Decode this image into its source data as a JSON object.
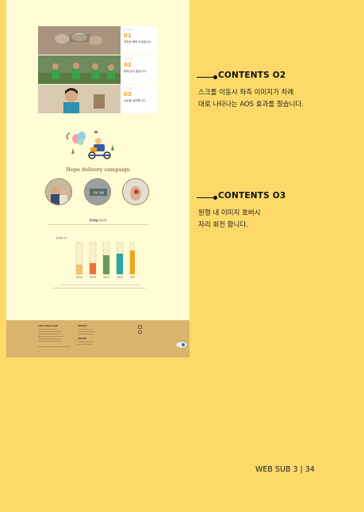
{
  "preview": {
    "cards": [
      {
        "small": "VOLUNTEER",
        "num": "01",
        "text": "따뜻한 행복 모금합니다."
      },
      {
        "small": "VOLUNTEER",
        "num": "02",
        "text": "함께 같이 돕습니다."
      },
      {
        "small": "VOLUNTEER",
        "num": "03",
        "text": "나눔을 실천합니다."
      }
    ],
    "campaign_title": "Hope delivery campaign",
    "circle_label": "기분 전환",
    "section_title": "희망배달 더보기?",
    "chart": {
      "label": "희망배달 모금",
      "years": [
        "2014",
        "2015",
        "2017",
        "2019",
        "2020"
      ]
    },
    "footer": {
      "col1_title": "LINE SUGAR CLUB",
      "col2_title": "SERVICE",
      "col3_title": "CENTER"
    }
  },
  "chart_data": {
    "type": "bar",
    "categories": [
      "2014",
      "2015",
      "2017",
      "2019",
      "2020"
    ],
    "values": [
      30,
      35,
      60,
      65,
      75
    ],
    "ylim": [
      0,
      100
    ],
    "colors": [
      "#f2c36b",
      "#e8743b",
      "#6a9a5a",
      "#2aa6a8",
      "#f3a21c"
    ]
  },
  "contents": [
    {
      "label": "CONTENTS O2",
      "lines": [
        "스크롤 이동시 좌측 이미지가 차례",
        "대로 나타나는 AOS 효과를 줬습니다."
      ]
    },
    {
      "label": "CONTENTS O3",
      "lines": [
        "원형 내 이미지 호버시",
        "자리 회전 합니다."
      ]
    }
  ],
  "page_footer": "WEB SUB 3  |   34",
  "colors": {
    "page_bg": "#fdd96a",
    "preview_bg": "#fffcd6",
    "accent": "#f3a21c",
    "footer_bg": "#d9b46c"
  }
}
